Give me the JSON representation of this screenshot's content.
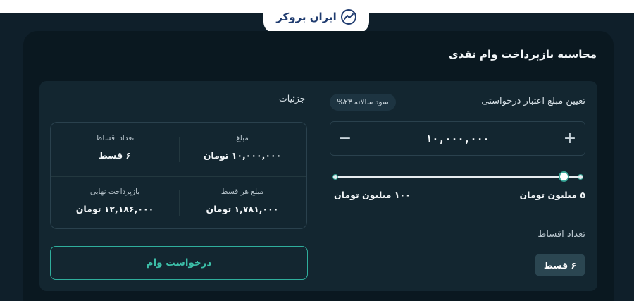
{
  "brand": {
    "name": "ایران بروکر",
    "logo_icon": "trend-chart-icon",
    "color": "#1f3b6f"
  },
  "card": {
    "title": "محاسبه بازپرداخت وام نقدی"
  },
  "loan": {
    "amount_label": "تعیین مبلغ اعتبار درخواستی",
    "rate_badge": "سود سالانه ۲۳%",
    "amount_value": "۱۰,۰۰۰,۰۰۰",
    "plus_symbol": "+",
    "minus_symbol": "−",
    "slider_level": 1.0,
    "range_min": "۵ میلیون تومان",
    "range_max": "۱۰۰ میلیون تومان",
    "installments_label": "تعداد اقساط",
    "installments_selected": "۶ قسط"
  },
  "details": {
    "title": "جزئیات",
    "cells": [
      {
        "label": "مبلغ",
        "value": "۱۰,۰۰۰,۰۰۰ تومان"
      },
      {
        "label": "تعداد اقساط",
        "value": "۶ قسط"
      },
      {
        "label": "مبلغ هر قسط",
        "value": "۱,۷۸۱,۰۰۰ تومان"
      },
      {
        "label": "بازپرداخت نهایی",
        "value": "۱۲,۱۸۶,۰۰۰ تومان"
      }
    ]
  },
  "actions": {
    "request_label": "درخواست وام"
  },
  "colors": {
    "accent": "#3cbfa8",
    "background": "#0f1f2a",
    "card": "#0a1820",
    "panel": "#132630"
  }
}
